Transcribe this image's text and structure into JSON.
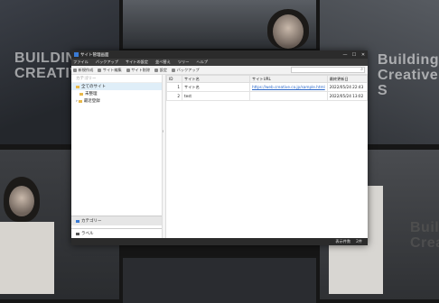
{
  "background": {
    "hero_left": [
      "BUILDING",
      "CREATIVE"
    ],
    "hero_right": [
      "Building",
      "Creative S"
    ],
    "hero_bottom_right": [
      "Build",
      "Creat"
    ]
  },
  "window": {
    "title": "サイト管理画面",
    "controls": [
      "—",
      "☐",
      "✕"
    ],
    "menu": [
      "ファイル",
      "バックアップ",
      "サイトの設定",
      "並べ替え",
      "ツリー",
      "ヘルプ"
    ],
    "toolbar": [
      "新規作成",
      "サイト編集",
      "サイト削除",
      "設定",
      "バックアップ"
    ],
    "search_icon": "magnifier"
  },
  "sidebar": {
    "header": "カテゴリー",
    "items": [
      {
        "label": "全てのサイト",
        "selected": true
      },
      {
        "label": "未整理"
      },
      {
        "label": "最近登録"
      }
    ],
    "bottom_tabs": [
      "カテゴリー",
      "ラベル"
    ]
  },
  "table": {
    "headers": [
      "ID",
      "サイト名",
      "サイトURL",
      "最終更新日"
    ],
    "rows": [
      {
        "id": "1",
        "name": "サイト名",
        "url": "https://web.creative.co.jp/sample.html",
        "date": "2022/05/24 22:43"
      },
      {
        "id": "2",
        "name": "test",
        "url": "",
        "date": "2022/05/24 13:02"
      }
    ]
  },
  "status": {
    "label": "表示件数",
    "count": "2件"
  }
}
